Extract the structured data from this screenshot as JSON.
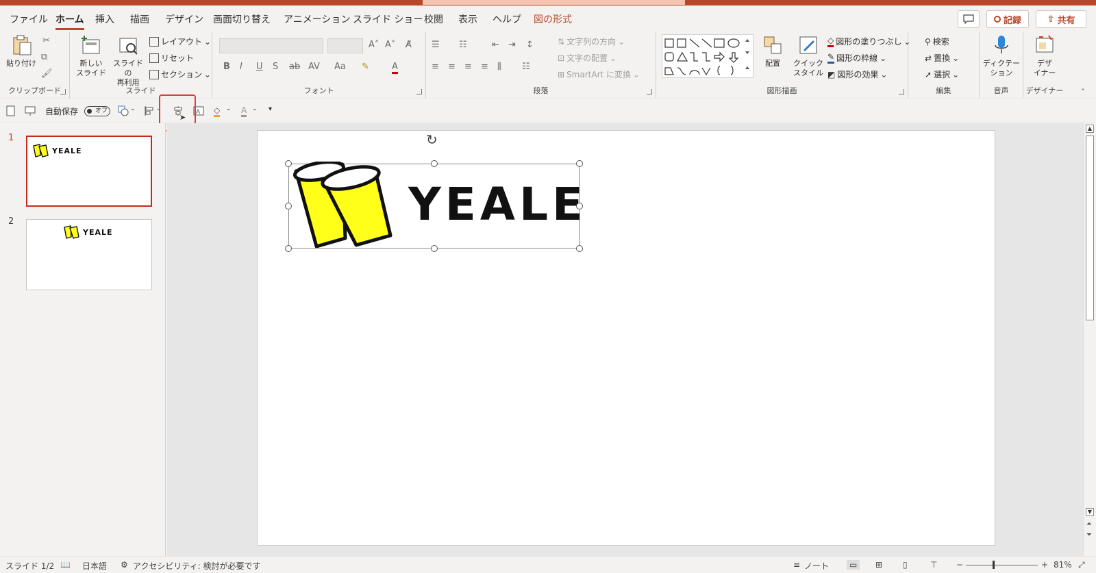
{
  "tabs": [
    "ファイル",
    "ホーム",
    "挿入",
    "描画",
    "デザイン",
    "画面切り替え",
    "アニメーション",
    "スライド ショー",
    "校閲",
    "表示",
    "ヘルプ",
    "図の形式"
  ],
  "active_tab": "ホーム",
  "header_buttons": {
    "record": "記録",
    "share": "共有"
  },
  "ribbon": {
    "clipboard": {
      "label": "クリップボード",
      "paste": "貼り付け"
    },
    "slides": {
      "label": "スライド",
      "new_slide_1": "新しい",
      "new_slide_2": "スライド",
      "reuse_1": "スライドの",
      "reuse_2": "再利用",
      "layout": "レイアウト",
      "reset": "リセット",
      "section": "セクション"
    },
    "font": {
      "label": "フォント"
    },
    "paragraph": {
      "label": "段落",
      "text_direction": "文字列の方向",
      "align_text": "文字の配置",
      "smartart": "SmartArt に変換"
    },
    "drawing": {
      "label": "図形描画",
      "arrange": "配置",
      "quick_styles_1": "クイック",
      "quick_styles_2": "スタイル",
      "fill": "図形の塗りつぶし",
      "outline": "図形の枠線",
      "effects": "図形の効果"
    },
    "editing": {
      "label": "編集",
      "find": "検索",
      "replace": "置換",
      "select": "選択"
    },
    "voice": {
      "label": "音声",
      "dictate_1": "ディクテー",
      "dictate_2": "ション"
    },
    "designer": {
      "label": "デザイナー",
      "design_1": "デザ",
      "design_2": "イナー"
    }
  },
  "qat": {
    "autosave": "自動保存",
    "toggle": "オフ"
  },
  "thumbnails": [
    {
      "number": "1",
      "logo": "YEALE"
    },
    {
      "number": "2",
      "logo": "YEALE"
    }
  ],
  "slide": {
    "logo_text": "YEALE"
  },
  "status": {
    "slide": "スライド 1/2",
    "language": "日本語",
    "accessibility": "アクセシビリティ: 検討が必要です",
    "notes": "ノート",
    "zoom": "81%"
  },
  "colors": {
    "accent": "#b7472a",
    "cup_yellow": "#ffff1a",
    "highlight": "#e03c3c"
  }
}
